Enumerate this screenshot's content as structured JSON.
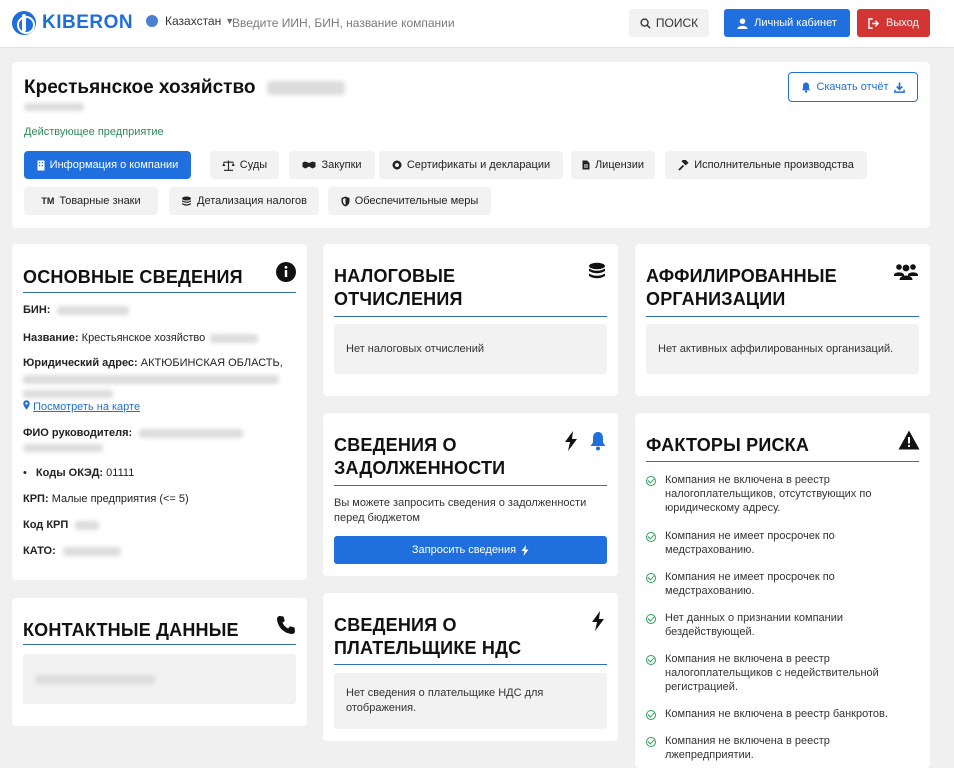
{
  "header": {
    "logo": "KIBERON",
    "country": "Казахстан",
    "search_placeholder": "Введите ИИН, БИН, название компании",
    "search_button": "ПОИСК",
    "cabinet_button": "Личный кабинет",
    "exit_button": "Выход"
  },
  "company": {
    "title": "Крестьянское хозяйство",
    "status": "Действующее предприятие",
    "download_button": "Скачать отчёт",
    "tabs": [
      {
        "label": "Информация о компании",
        "active": true
      },
      {
        "label": "Суды"
      },
      {
        "label": "Закупки"
      },
      {
        "label": "Сертификаты и декларации"
      },
      {
        "label": "Лицензии"
      },
      {
        "label": "Исполнительные производства"
      },
      {
        "label": "Товарные знаки"
      },
      {
        "label": "Детализация налогов"
      },
      {
        "label": "Обеспечительные меры"
      }
    ]
  },
  "basic": {
    "title": "ОСНОВНЫЕ СВЕДЕНИЯ",
    "bin_label": "БИН:",
    "name_label": "Название:",
    "name_value": "Крестьянское хозяйство",
    "address_label": "Юридический адрес:",
    "address_value": "АКТЮБИНСКАЯ ОБЛАСТЬ,",
    "map_link": "Посмотреть на карте",
    "head_label": "ФИО руководителя:",
    "oked_label": "Коды ОКЭД:",
    "oked_value": "01111",
    "krp_label": "КРП:",
    "krp_value": "Малые предприятия (<= 5)",
    "krp_code_label": "Код КРП",
    "kato_label": "КАТО:"
  },
  "contacts": {
    "title": "КОНТАКТНЫЕ ДАННЫЕ"
  },
  "tax": {
    "title_1": "НАЛОГОВЫЕ",
    "title_2": "ОТЧИСЛЕНИЯ",
    "empty": "Нет налоговых отчислений"
  },
  "debt": {
    "title_1": "СВЕДЕНИЯ О",
    "title_2": "ЗАДОЛЖЕННОСТИ",
    "text": "Вы можете запросить сведения о задолженности перед бюджетом",
    "button": "Запросить сведения"
  },
  "vat": {
    "title_1": "СВЕДЕНИЯ О",
    "title_2": "ПЛАТЕЛЬЩИКЕ НДС",
    "empty": "Нет сведения о плательщике НДС для отображения."
  },
  "affiliated": {
    "title_1": "АФФИЛИРОВАННЫЕ",
    "title_2": "ОРГАНИЗАЦИИ",
    "empty": "Нет активных аффилированных организаций."
  },
  "risk": {
    "title": "ФАКТОРЫ РИСКА",
    "items": [
      "Компания не включена в реестр налогоплательщиков, отсутствующих по юридическому адресу.",
      "Компания не имеет просрочек по медстрахованию.",
      "Компания не имеет просрочек по медстрахованию.",
      "Нет данных о признании компании бездействующей.",
      "Компания не включена в реестр налогоплательщиков с недействительной регистрацией.",
      "Компания не включена в реестр банкротов.",
      "Компания не включена в реестр лжепредприятии."
    ]
  },
  "colors": {
    "primary": "#1f6fde",
    "danger": "#d33434",
    "success": "#2e8b57",
    "background": "#f0f0f0"
  }
}
